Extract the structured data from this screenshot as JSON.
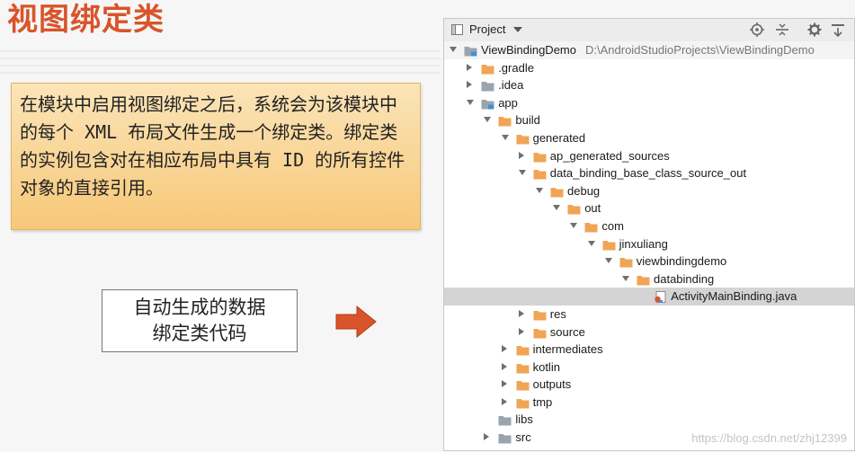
{
  "slide": {
    "title": "视图绑定类",
    "note_text": "在模块中启用视图绑定之后，系统会为该模块中的每个 XML 布局文件生成一个绑定类。绑定类的实例包含对在相应布局中具有 ID 的所有控件对象的直接引用。",
    "generated_box_line1": "自动生成的数据",
    "generated_box_line2": "绑定类代码",
    "arrow_color": "#d9542a",
    "title_color": "#d9542a"
  },
  "panel": {
    "view_label": "Project",
    "toolbar_icons": [
      "locate-icon",
      "collapse-all-icon",
      "settings-gear-icon",
      "hide-panel-icon"
    ],
    "tree": [
      {
        "label": "ViewBindingDemo",
        "path": "D:\\AndroidStudioProjects\\ViewBindingDemo",
        "depth": 0,
        "expanded": true,
        "icon": "project-folder-icon"
      },
      {
        "label": ".gradle",
        "depth": 1,
        "expanded": false,
        "icon": "folder-orange-icon"
      },
      {
        "label": ".idea",
        "depth": 1,
        "expanded": false,
        "icon": "folder-gray-icon"
      },
      {
        "label": "app",
        "depth": 1,
        "expanded": true,
        "icon": "module-folder-icon"
      },
      {
        "label": "build",
        "depth": 2,
        "expanded": true,
        "icon": "folder-orange-icon"
      },
      {
        "label": "generated",
        "depth": 3,
        "expanded": true,
        "icon": "folder-orange-icon"
      },
      {
        "label": "ap_generated_sources",
        "depth": 4,
        "expanded": false,
        "icon": "folder-orange-icon"
      },
      {
        "label": "data_binding_base_class_source_out",
        "depth": 4,
        "expanded": true,
        "icon": "folder-orange-icon"
      },
      {
        "label": "debug",
        "depth": 5,
        "expanded": true,
        "icon": "folder-orange-icon"
      },
      {
        "label": "out",
        "depth": 6,
        "expanded": true,
        "icon": "folder-orange-icon"
      },
      {
        "label": "com",
        "depth": 7,
        "expanded": true,
        "icon": "folder-orange-icon"
      },
      {
        "label": "jinxuliang",
        "depth": 8,
        "expanded": true,
        "icon": "folder-orange-icon"
      },
      {
        "label": "viewbindingdemo",
        "depth": 9,
        "expanded": true,
        "icon": "folder-orange-icon"
      },
      {
        "label": "databinding",
        "depth": 10,
        "expanded": true,
        "icon": "folder-orange-icon"
      },
      {
        "label": "ActivityMainBinding.java",
        "depth": 11,
        "leaf": true,
        "selected": true,
        "icon": "java-file-icon"
      },
      {
        "label": "res",
        "depth": 4,
        "expanded": false,
        "icon": "folder-orange-icon"
      },
      {
        "label": "source",
        "depth": 4,
        "expanded": false,
        "icon": "folder-orange-icon"
      },
      {
        "label": "intermediates",
        "depth": 3,
        "expanded": false,
        "icon": "folder-orange-icon"
      },
      {
        "label": "kotlin",
        "depth": 3,
        "expanded": false,
        "icon": "folder-orange-icon"
      },
      {
        "label": "outputs",
        "depth": 3,
        "expanded": false,
        "icon": "folder-orange-icon"
      },
      {
        "label": "tmp",
        "depth": 3,
        "expanded": false,
        "icon": "folder-orange-icon"
      },
      {
        "label": "libs",
        "depth": 2,
        "leaf": true,
        "icon": "folder-gray-icon"
      },
      {
        "label": "src",
        "depth": 2,
        "expanded": false,
        "icon": "folder-gray-icon"
      }
    ],
    "colors": {
      "folder_orange": "#f0a456",
      "folder_gray": "#9aa4ad",
      "selection": "#d4d4d4"
    }
  },
  "watermark": "https://blog.csdn.net/zhj12399"
}
